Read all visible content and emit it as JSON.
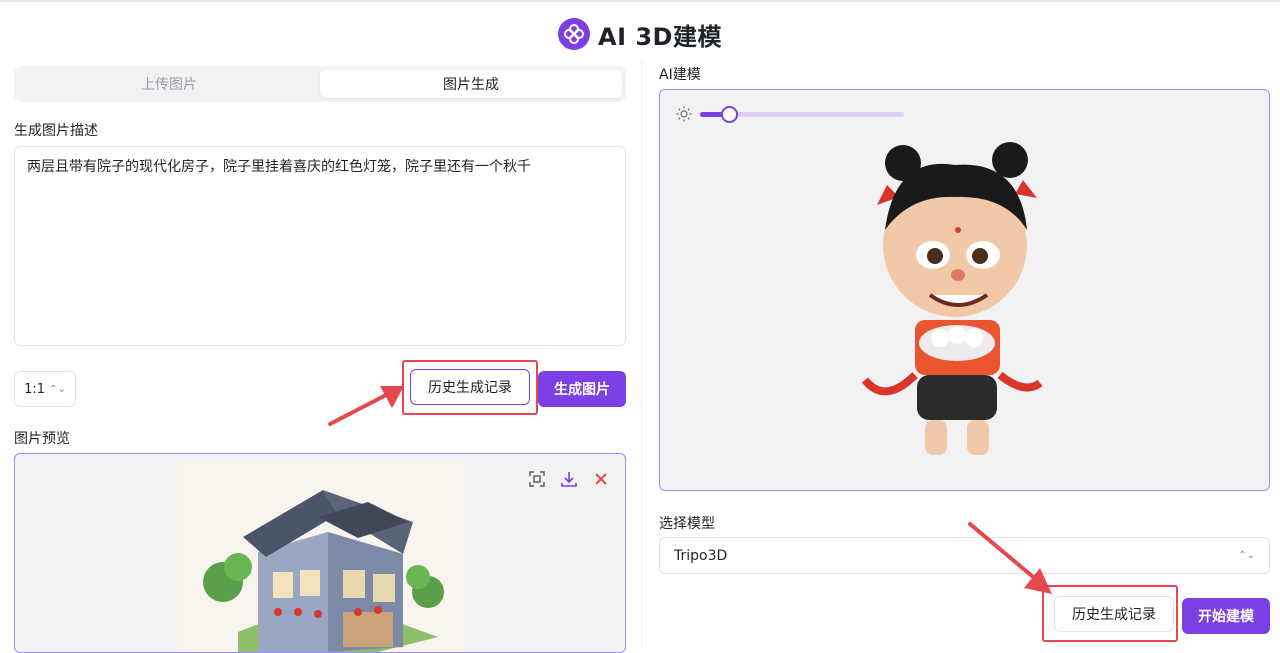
{
  "header": {
    "title": "AI 3D建模"
  },
  "left": {
    "tabs": [
      {
        "label": "上传图片",
        "active": false
      },
      {
        "label": "图片生成",
        "active": true
      }
    ],
    "description_label": "生成图片描述",
    "description_value": "两层且带有院子的现代化房子，院子里挂着喜庆的红色灯笼，院子里还有一个秋千",
    "ratio_value": "1:1",
    "history_button": "历史生成记录",
    "generate_button": "生成图片",
    "preview_label": "图片预览",
    "preview_tools": [
      "fullscreen-icon",
      "download-icon",
      "close-icon"
    ]
  },
  "right": {
    "model_label": "AI建模",
    "light_slider_percent": 14,
    "select_model_label": "选择模型",
    "select_model_value": "Tripo3D",
    "history_button": "历史生成记录",
    "start_button": "开始建模"
  },
  "colors": {
    "accent": "#7b3fe4",
    "highlight": "#e5484d",
    "panel_bg": "#f2f2f4"
  }
}
